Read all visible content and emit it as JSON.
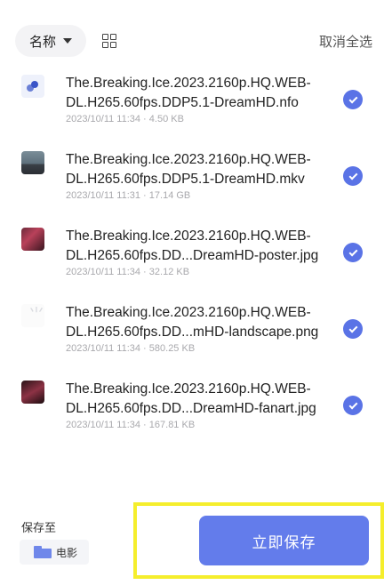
{
  "toolbar": {
    "sort_label": "名称",
    "deselect_all": "取消全选"
  },
  "files": [
    {
      "name": "The.Breaking.Ice.2023.2160p.HQ.WEB-DL.H265.60fps.DDP5.1-DreamHD.nfo",
      "meta": "2023/10/11 11:34 · 4.50 KB",
      "selected": true
    },
    {
      "name": "The.Breaking.Ice.2023.2160p.HQ.WEB-DL.H265.60fps.DDP5.1-DreamHD.mkv",
      "meta": "2023/10/11 11:31 · 17.14 GB",
      "selected": true
    },
    {
      "name": "The.Breaking.Ice.2023.2160p.HQ.WEB-DL.H265.60fps.DD...DreamHD-poster.jpg",
      "meta": "2023/10/11 11:34 · 32.12 KB",
      "selected": true
    },
    {
      "name": "The.Breaking.Ice.2023.2160p.HQ.WEB-DL.H265.60fps.DD...mHD-landscape.png",
      "meta": "2023/10/11 11:34 · 580.25 KB",
      "selected": true
    },
    {
      "name": "The.Breaking.Ice.2023.2160p.HQ.WEB-DL.H265.60fps.DD...DreamHD-fanart.jpg",
      "meta": "2023/10/11 11:34 · 167.81 KB",
      "selected": true
    }
  ],
  "footer": {
    "save_to_label": "保存至",
    "folder_name": "电影",
    "save_now": "立即保存"
  },
  "colors": {
    "accent": "#637ceb",
    "checkbox": "#5a73e6",
    "highlight": "#f5ee2c"
  }
}
